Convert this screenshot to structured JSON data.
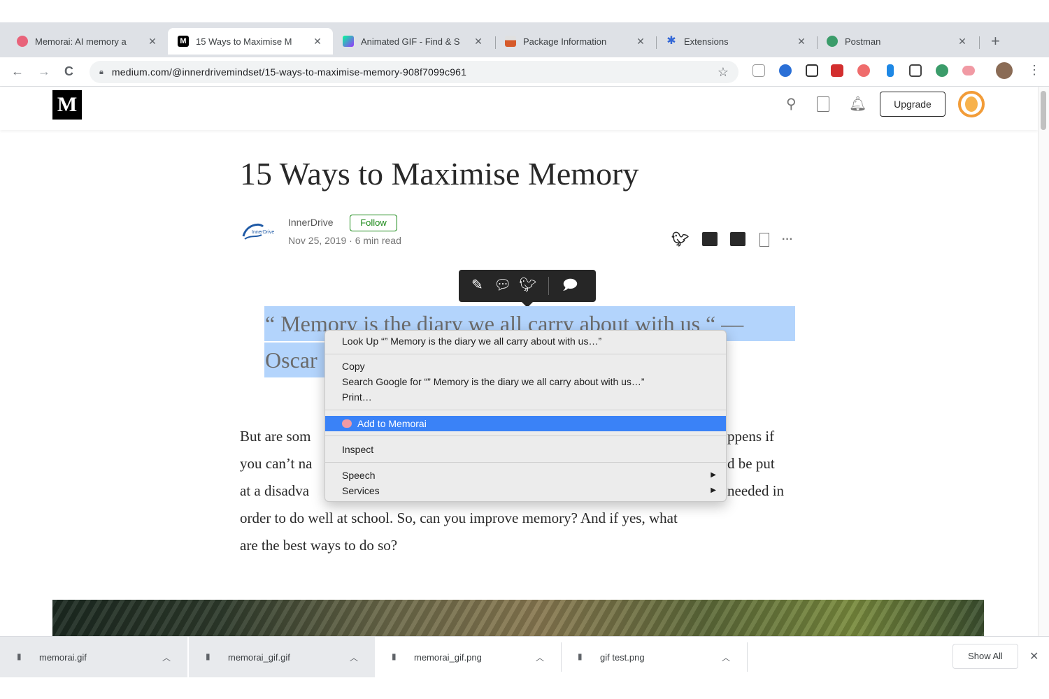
{
  "tabs": [
    {
      "title": "Memorai: AI memory a",
      "color": "#e8637a"
    },
    {
      "title": "15 Ways to Maximise M",
      "color": "#000000"
    },
    {
      "title": "Animated GIF - Find & S",
      "color": "#111111"
    },
    {
      "title": "Package Information",
      "color": "#d65a2b"
    },
    {
      "title": "Extensions",
      "color": "#3367d6"
    },
    {
      "title": "Postman",
      "color": "#3b9c6a"
    }
  ],
  "toolbar": {
    "url": "medium.com/@innerdrivemindset/15-ways-to-maximise-memory-908f7099c961",
    "back": "←",
    "forward": "→",
    "reload": "C",
    "star": "☆",
    "menu": "⋮",
    "new_tab": "+"
  },
  "header": {
    "logo": "M",
    "upgrade": "Upgrade"
  },
  "article": {
    "title": "15 Ways to Maximise Memory",
    "author": "InnerDrive",
    "follow": "Follow",
    "meta": "Nov 25, 2019 · 6 min read",
    "author_logo_text": "InnerDrive",
    "quote_line1": "“ Memory is the diary we all carry about with us “ —",
    "quote_line2": "Oscar",
    "body": [
      {
        "left": "But are som",
        "right": "ppens if"
      },
      {
        "left": "you can’t na",
        "right": "d be put"
      },
      {
        "left": "at a disadva",
        "right": "needed in"
      },
      {
        "full": "order to do well at school. So, can you improve memory? And if yes, what"
      },
      {
        "full": "are the best ways to do so?"
      }
    ]
  },
  "context_menu": {
    "lookup": "Look Up “” Memory is the diary we all carry about with us…”",
    "copy": "Copy",
    "search": "Search Google for “” Memory is the diary we all carry about with us…”",
    "print": "Print…",
    "add": "Add to Memorai",
    "inspect": "Inspect",
    "speech": "Speech",
    "services": "Services"
  },
  "downloads": {
    "items": [
      "memorai.gif",
      "memorai_gif.gif",
      "memorai_gif.png",
      "gif test.png"
    ],
    "show_all": "Show All"
  },
  "colors": {
    "highlight": "#b3d4fc",
    "menu_selected": "#3a82f7",
    "follow_green": "#1a8917"
  }
}
